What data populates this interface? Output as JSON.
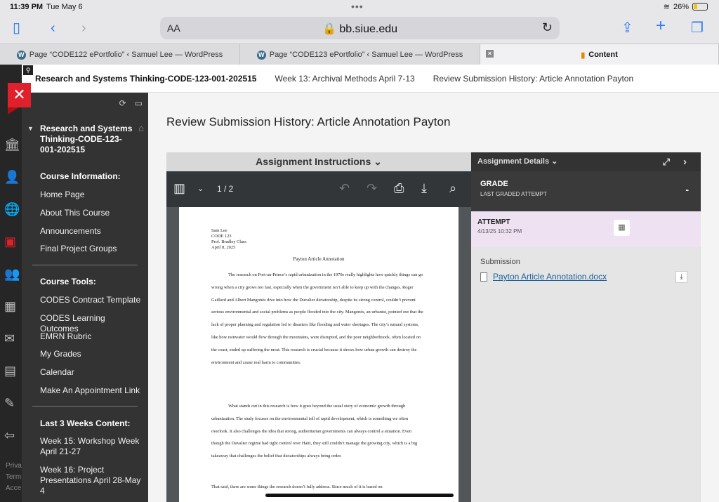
{
  "status_bar": {
    "time": "11:39 PM",
    "date": "Tue May 6",
    "battery": "26%"
  },
  "browser": {
    "address": {
      "aa_label": "AA",
      "url": "bb.siue.edu"
    },
    "tabs": [
      {
        "label": "Page “CODE122 ePortfolio” ‹ Samuel Lee — WordPress",
        "icon": "wordpress-icon"
      },
      {
        "label": "Page “CODE123 ePortfolio” ‹ Samuel Lee — WordPress",
        "icon": "wordpress-icon"
      },
      {
        "label": "Content",
        "icon": "blackboard-icon",
        "active": true
      }
    ]
  },
  "breadcrumb": {
    "items": [
      "Research and Systems Thinking-CODE-123-001-202515",
      "Week 13: Archival Methods April 7-13",
      "Review Submission History: Article Annotation Payton"
    ]
  },
  "course_nav": {
    "course_title": "Research and Systems Thinking-CODE-123-001-202515",
    "sections": [
      {
        "heading": "Course Information:",
        "items": [
          "Home Page",
          "About This Course",
          "Announcements",
          "Final Project Groups"
        ]
      },
      {
        "heading": "Course Tools:",
        "items": [
          "CODES Contract Template",
          "CODES Learning Outcomes",
          "EMRN Rubric",
          "My Grades",
          "Calendar",
          "Make An Appointment Link"
        ]
      },
      {
        "heading": "Last 3 Weeks Content:",
        "items": [
          "Week 15: Workshop Week April 21-27",
          "Week 16: Project Presentations April 28-May 4"
        ]
      }
    ]
  },
  "left_rail_footer": [
    "Priva",
    "Term",
    "Acce"
  ],
  "main": {
    "page_title": "Review Submission History: Article Annotation Payton",
    "instructions_label": "Assignment Instructions",
    "viewer": {
      "page_indicator": "1 / 2"
    },
    "document": {
      "header_lines": [
        "Sam Lee",
        "CODE 123",
        "Prof. Bradley Class",
        "April 8, 2025"
      ],
      "title": "Payton Article Annotation",
      "paragraphs": [
        "The research on Port-au-Prince’s rapid urbanization in the 1970s really highlights how quickly things can go wrong when a city grows too fast, especially when the government isn’t able to keep up with the changes. Roger Gaillard and Albert Mangonès dive into how the Duvalier dictatorship, despite its strong control, couldn’t prevent serious environmental and social problems as people flooded into the city. Mangonès, an urbanist, pointed out that the lack of proper planning and regulation led to disasters like flooding and water shortages. The city’s natural systems, like how rainwater would flow through the mountains, were disrupted, and the poor neighborhoods, often located on the coast, ended up suffering the most. This research is crucial because it shows how urban growth can destroy the environment and cause real harm to communities.",
        "What stands out in this research is how it goes beyond the usual story of economic growth through urbanization. The study focuses on the environmental toll of rapid development, which is something we often overlook. It also challenges the idea that strong, authoritarian governments can always control a situation. Even though the Duvalier regime had tight control over Haiti, they still couldn’t manage the growing city, which is a big takeaway that challenges the belief that dictatorships always bring order.",
        "That said, there are some things the research doesn’t fully address. Since much of it is based on"
      ]
    },
    "details": {
      "header": "Assignment Details",
      "grade_label": "GRADE",
      "grade_sub": "LAST GRADED ATTEMPT",
      "grade_value": "-",
      "attempt_label": "ATTEMPT",
      "attempt_time": "4/13/25 10:32 PM",
      "submission_label": "Submission",
      "submission_file": "Payton Article Annotation.docx"
    }
  }
}
